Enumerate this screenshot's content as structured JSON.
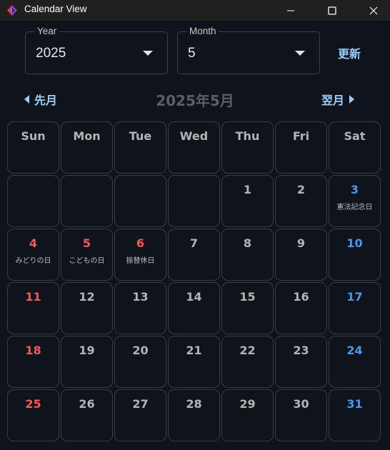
{
  "window": {
    "title": "Calendar View"
  },
  "controls": {
    "year": {
      "label": "Year",
      "value": "2025"
    },
    "month": {
      "label": "Month",
      "value": "5"
    },
    "refresh_label": "更新"
  },
  "nav": {
    "prev_label": "先月",
    "next_label": "翌月",
    "title": "2025年5月"
  },
  "colors": {
    "holiday_red": "#f25a5a",
    "saturday_blue": "#4a96f5",
    "accent": "#9ccdfc"
  },
  "weekdays": [
    "Sun",
    "Mon",
    "Tue",
    "Wed",
    "Thu",
    "Fri",
    "Sat"
  ],
  "days": [
    {
      "day": "",
      "holiday": "",
      "kind": "empty"
    },
    {
      "day": "",
      "holiday": "",
      "kind": "empty"
    },
    {
      "day": "",
      "holiday": "",
      "kind": "empty"
    },
    {
      "day": "",
      "holiday": "",
      "kind": "empty"
    },
    {
      "day": "1",
      "holiday": "",
      "kind": "normal"
    },
    {
      "day": "2",
      "holiday": "",
      "kind": "normal"
    },
    {
      "day": "3",
      "holiday": "憲法記念日",
      "kind": "saturday"
    },
    {
      "day": "4",
      "holiday": "みどりの日",
      "kind": "holiday"
    },
    {
      "day": "5",
      "holiday": "こどもの日",
      "kind": "holiday"
    },
    {
      "day": "6",
      "holiday": "振替休日",
      "kind": "holiday"
    },
    {
      "day": "7",
      "holiday": "",
      "kind": "normal"
    },
    {
      "day": "8",
      "holiday": "",
      "kind": "normal"
    },
    {
      "day": "9",
      "holiday": "",
      "kind": "normal"
    },
    {
      "day": "10",
      "holiday": "",
      "kind": "saturday"
    },
    {
      "day": "11",
      "holiday": "",
      "kind": "holiday"
    },
    {
      "day": "12",
      "holiday": "",
      "kind": "normal"
    },
    {
      "day": "13",
      "holiday": "",
      "kind": "normal"
    },
    {
      "day": "14",
      "holiday": "",
      "kind": "normal"
    },
    {
      "day": "15",
      "holiday": "",
      "kind": "normal"
    },
    {
      "day": "16",
      "holiday": "",
      "kind": "normal"
    },
    {
      "day": "17",
      "holiday": "",
      "kind": "saturday"
    },
    {
      "day": "18",
      "holiday": "",
      "kind": "holiday"
    },
    {
      "day": "19",
      "holiday": "",
      "kind": "normal"
    },
    {
      "day": "20",
      "holiday": "",
      "kind": "normal"
    },
    {
      "day": "21",
      "holiday": "",
      "kind": "normal"
    },
    {
      "day": "22",
      "holiday": "",
      "kind": "normal"
    },
    {
      "day": "23",
      "holiday": "",
      "kind": "normal"
    },
    {
      "day": "24",
      "holiday": "",
      "kind": "saturday"
    },
    {
      "day": "25",
      "holiday": "",
      "kind": "holiday"
    },
    {
      "day": "26",
      "holiday": "",
      "kind": "normal"
    },
    {
      "day": "27",
      "holiday": "",
      "kind": "normal"
    },
    {
      "day": "28",
      "holiday": "",
      "kind": "normal"
    },
    {
      "day": "29",
      "holiday": "",
      "kind": "normal"
    },
    {
      "day": "30",
      "holiday": "",
      "kind": "normal"
    },
    {
      "day": "31",
      "holiday": "",
      "kind": "saturday"
    }
  ]
}
